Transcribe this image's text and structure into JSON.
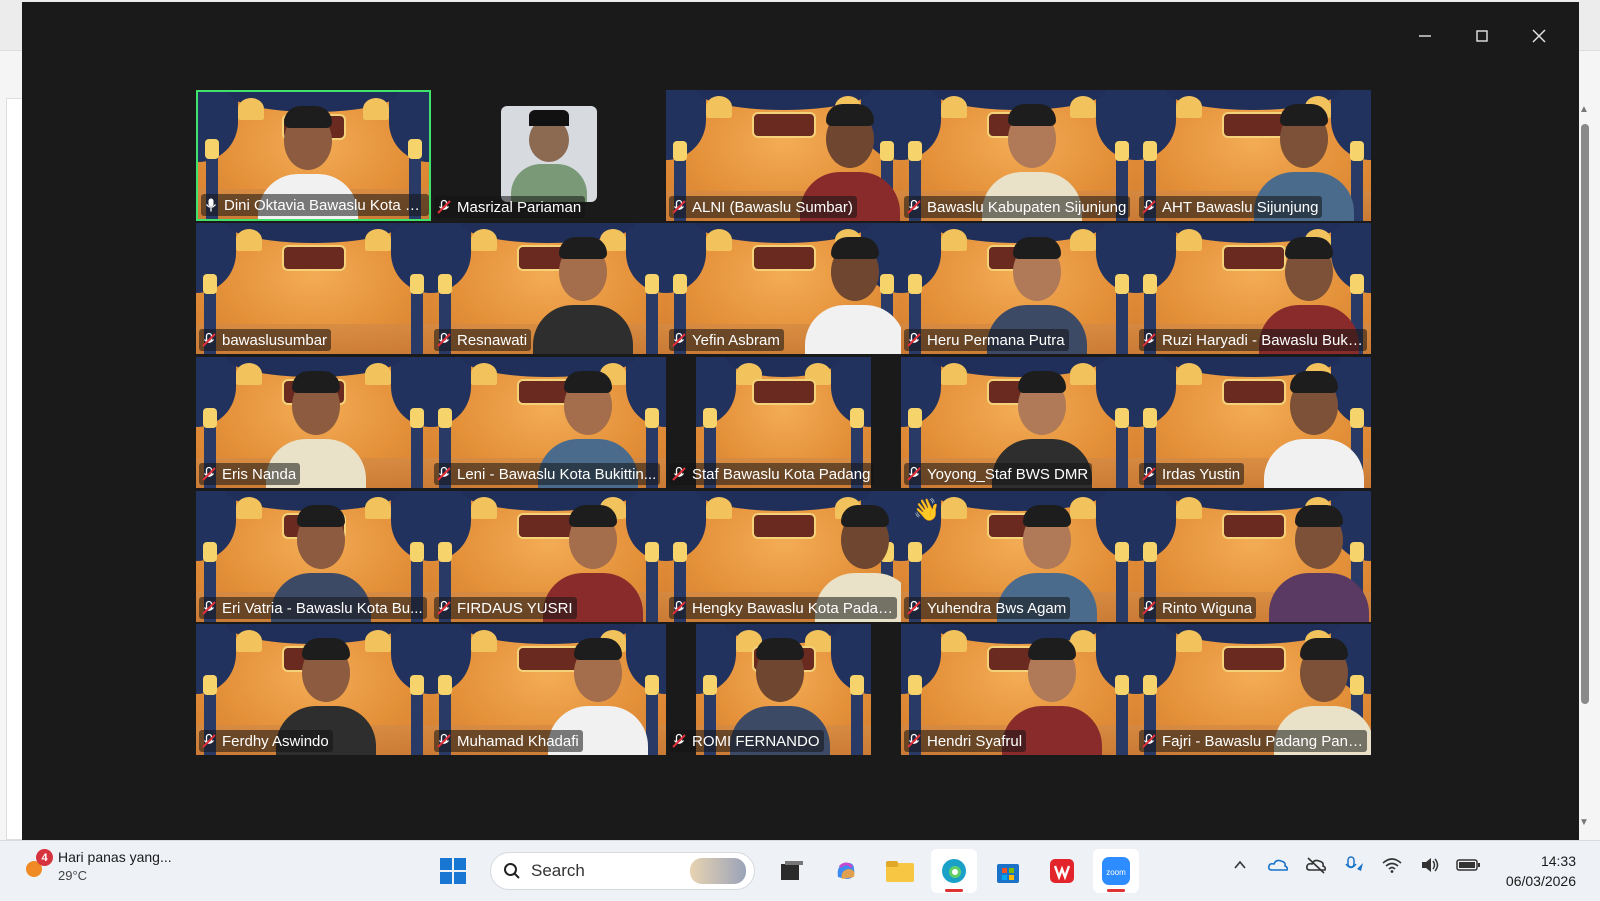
{
  "window": {
    "controls": [
      "minimize",
      "maximize",
      "close"
    ]
  },
  "participants": [
    {
      "name": "Dini Oktavia Bawaslu Kota B...",
      "active": true,
      "mic": "unmuted"
    },
    {
      "name": "Masrizal Pariaman",
      "mic": "muted"
    },
    {
      "name": "ALNI (Bawaslu Sumbar)",
      "mic": "muted"
    },
    {
      "name": "Bawaslu Kabupaten Sijunjung",
      "mic": "muted"
    },
    {
      "name": "AHT Bawaslu Sijunjung",
      "mic": "muted"
    },
    {
      "name": "bawaslusumbar",
      "mic": "muted"
    },
    {
      "name": "Resnawati",
      "mic": "muted"
    },
    {
      "name": "Yefin Asbram",
      "mic": "muted"
    },
    {
      "name": "Heru Permana Putra",
      "mic": "muted"
    },
    {
      "name": "Ruzi Haryadi - Bawaslu Buki...",
      "mic": "muted"
    },
    {
      "name": "Eris Nanda",
      "mic": "muted"
    },
    {
      "name": "Leni - Bawaslu Kota Bukittin...",
      "mic": "muted"
    },
    {
      "name": "Staf Bawaslu Kota Padang",
      "mic": "muted"
    },
    {
      "name": "Yoyong_Staf BWS DMR",
      "mic": "muted"
    },
    {
      "name": "Irdas Yustin",
      "mic": "muted"
    },
    {
      "name": "Eri Vatria - Bawaslu Kota Bu...",
      "mic": "muted"
    },
    {
      "name": "FIRDAUS YUSRI",
      "mic": "muted"
    },
    {
      "name": "Hengky Bawaslu Kota Padang",
      "mic": "muted"
    },
    {
      "name": "Yuhendra Bws Agam",
      "mic": "muted"
    },
    {
      "name": "Rinto Wiguna",
      "mic": "muted"
    },
    {
      "name": "Ferdhy Aswindo",
      "mic": "muted"
    },
    {
      "name": "Muhamad Khadafi",
      "mic": "muted"
    },
    {
      "name": "ROMI FERNANDO",
      "mic": "muted"
    },
    {
      "name": "Hendri Syafrul",
      "mic": "muted"
    },
    {
      "name": "Fajri - Bawaslu Padang Panj...",
      "mic": "muted"
    }
  ],
  "taskbar": {
    "weather": {
      "title": "Hari panas yang...",
      "temp": "29°C",
      "badge": "4"
    },
    "search": {
      "label": "Search"
    },
    "apps": [
      "windows-start",
      "task-view",
      "copilot",
      "file-explorer",
      "edge",
      "microsoft-store",
      "wps-office",
      "zoom"
    ],
    "clock": {
      "time": "14:33",
      "date": "06/03/2026"
    }
  },
  "colors": {
    "active_speaker": "#3fe36b",
    "muted_mic": "#e0303a",
    "window_bg": "#1a1a1a"
  }
}
